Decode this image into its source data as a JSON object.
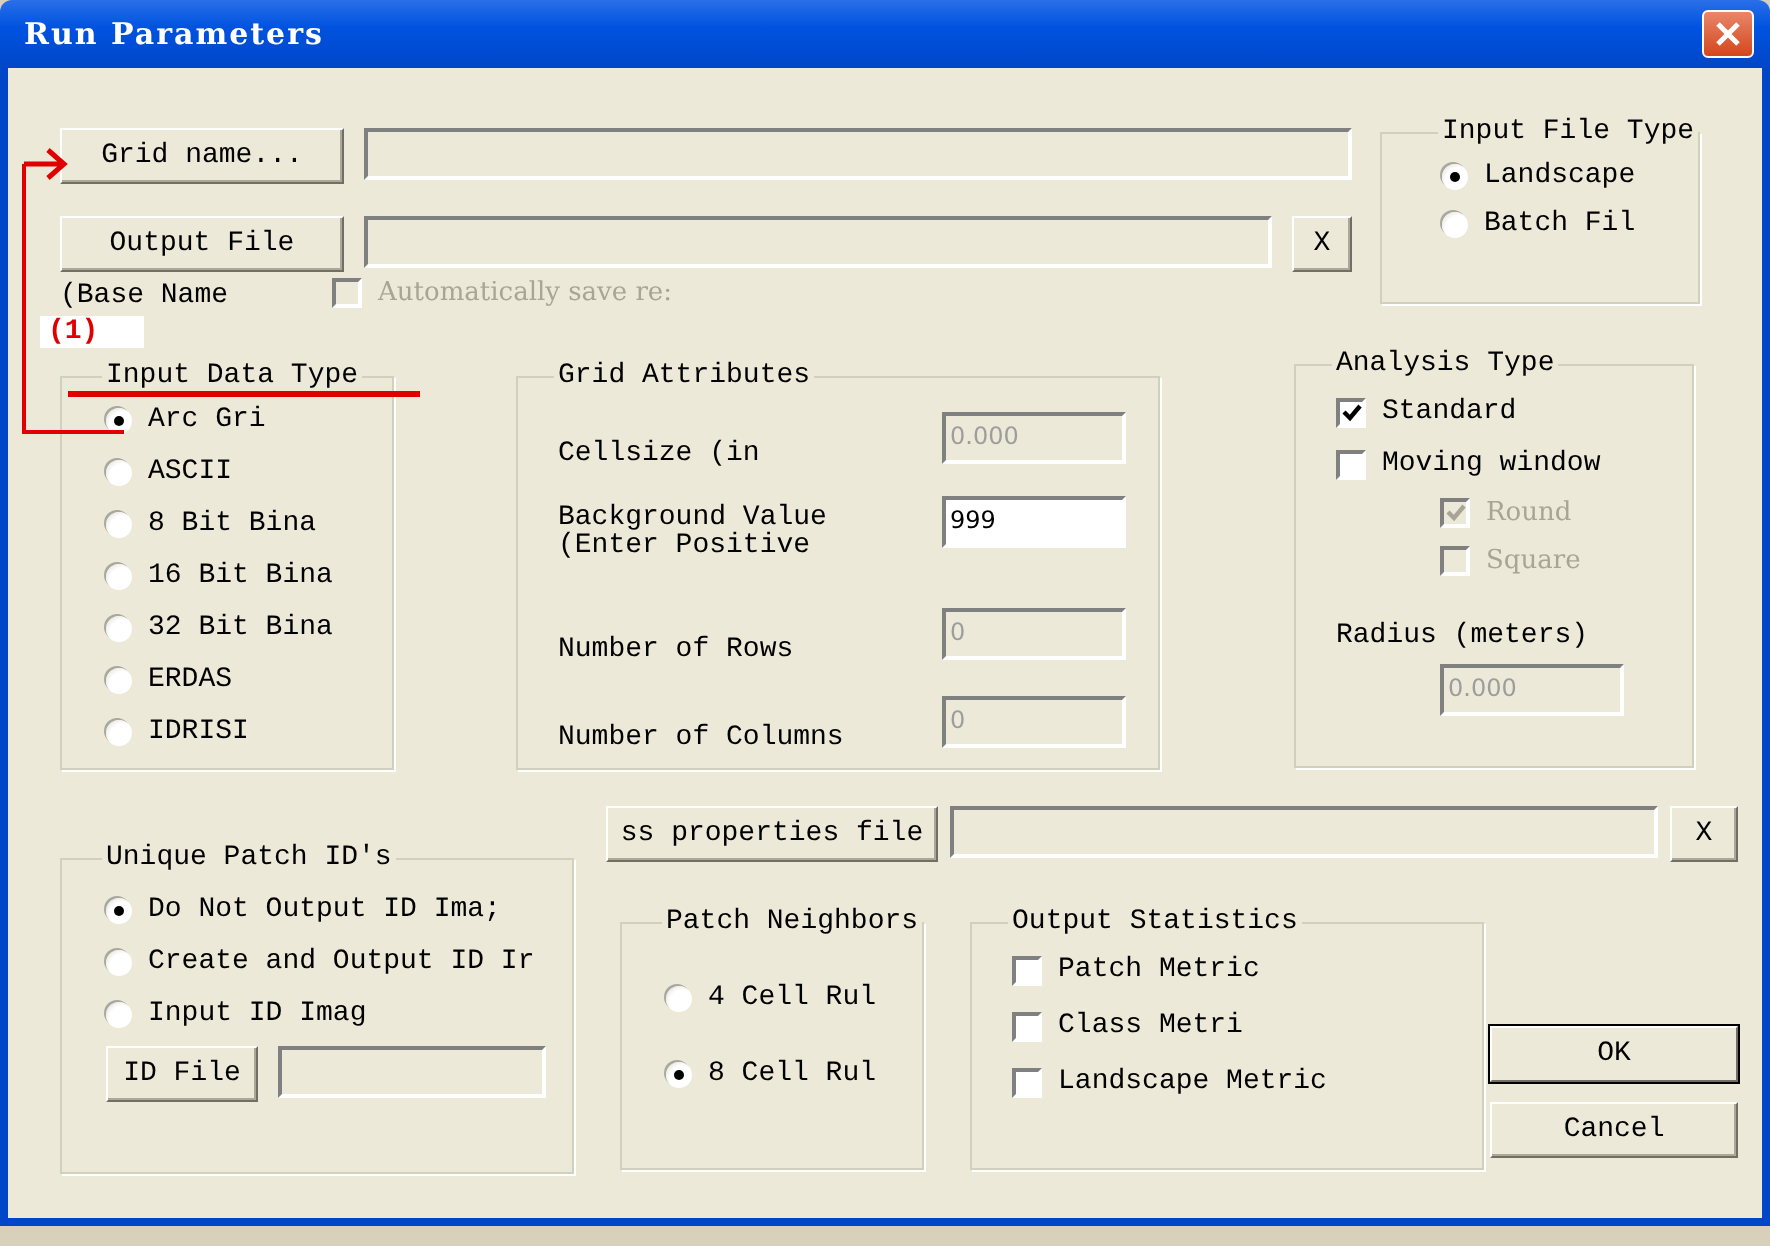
{
  "window": {
    "title": "Run Parameters"
  },
  "grid_name": {
    "button": "Grid name..."
  },
  "output_file": {
    "button": "Output File",
    "clear_button": "X",
    "note": "(Base Name"
  },
  "auto_save": {
    "label": "Automatically save re:",
    "checked": false,
    "disabled": true
  },
  "annotation": {
    "label": "(1)"
  },
  "input_file_type": {
    "title": "Input File Type",
    "options": [
      {
        "label": "Landscape",
        "selected": true
      },
      {
        "label": "Batch Fil",
        "selected": false
      }
    ]
  },
  "input_data_type": {
    "title": "Input Data Type",
    "options": [
      {
        "label": "Arc Gri",
        "selected": true
      },
      {
        "label": "ASCII",
        "selected": false
      },
      {
        "label": "8 Bit Bina",
        "selected": false
      },
      {
        "label": "16 Bit Bina",
        "selected": false
      },
      {
        "label": "32 Bit Bina",
        "selected": false
      },
      {
        "label": "ERDAS",
        "selected": false
      },
      {
        "label": "IDRISI",
        "selected": false
      }
    ]
  },
  "grid_attributes": {
    "title": "Grid Attributes",
    "fields": [
      {
        "label": "Cellsize (in",
        "value": "0.000",
        "disabled": true
      },
      {
        "label": "Background Value",
        "note": "(Enter Positive",
        "value": "999",
        "disabled": false
      },
      {
        "label": "Number of Rows",
        "value": "0",
        "disabled": true
      },
      {
        "label": "Number of Columns",
        "value": "0",
        "disabled": true
      }
    ]
  },
  "analysis_type": {
    "title": "Analysis Type",
    "options": [
      {
        "label": "Standard",
        "checked": true,
        "disabled": false
      },
      {
        "label": "Moving window",
        "checked": false,
        "disabled": false,
        "children": [
          {
            "label": "Round",
            "checked": true,
            "disabled": true
          },
          {
            "label": "Square",
            "checked": false,
            "disabled": true
          }
        ]
      }
    ],
    "radius": {
      "label": "Radius (meters)",
      "value": "0.000",
      "disabled": true
    }
  },
  "unique_patch_ids": {
    "title": "Unique Patch ID's",
    "options": [
      {
        "label": "Do Not Output ID Ima;",
        "selected": true
      },
      {
        "label": "Create and Output ID Ir",
        "selected": false
      },
      {
        "label": "Input ID Imag",
        "selected": false
      }
    ],
    "id_file_button": "ID File"
  },
  "class_properties": {
    "button": "ss properties file",
    "clear_button": "X"
  },
  "patch_neighbors": {
    "title": "Patch Neighbors",
    "options": [
      {
        "label": "4 Cell Rul",
        "selected": false
      },
      {
        "label": "8 Cell Rul",
        "selected": true
      }
    ]
  },
  "output_statistics": {
    "title": "Output Statistics",
    "options": [
      {
        "label": "Patch Metric",
        "checked": false
      },
      {
        "label": "Class Metri",
        "checked": false
      },
      {
        "label": "Landscape Metric",
        "checked": false
      }
    ]
  },
  "buttons": [
    {
      "label": "OK",
      "default": true
    },
    {
      "label": "Cancel",
      "default": false
    }
  ]
}
